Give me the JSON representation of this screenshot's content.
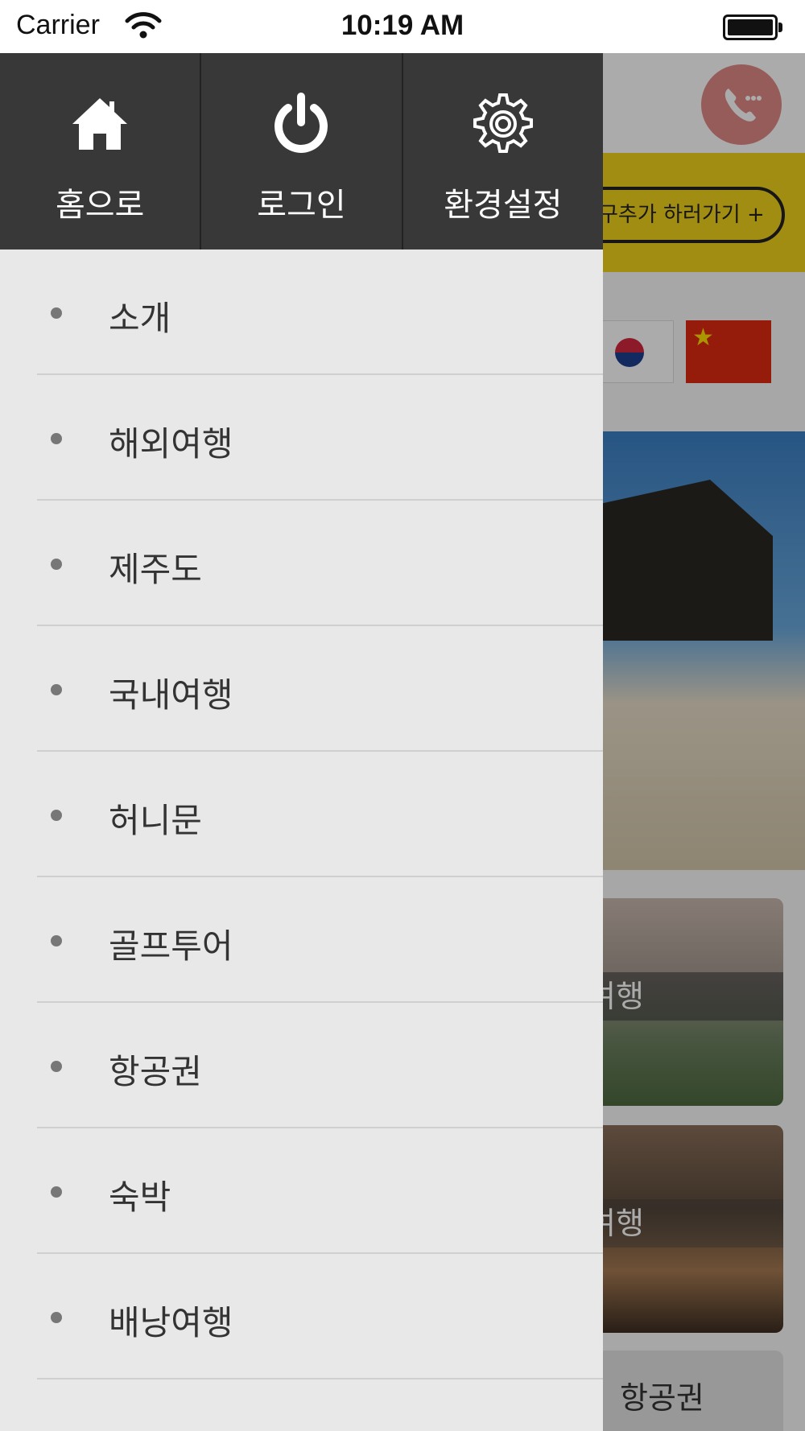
{
  "status_bar": {
    "carrier": "Carrier",
    "time": "10:19 AM",
    "wifi_icon": "wifi-icon",
    "battery_icon": "battery-icon"
  },
  "drawer": {
    "top_buttons": [
      {
        "label": "홈으로",
        "icon": "home-icon"
      },
      {
        "label": "로그인",
        "icon": "power-icon"
      },
      {
        "label": "환경설정",
        "icon": "gear-icon"
      }
    ],
    "menu_items": [
      {
        "label": "소개"
      },
      {
        "label": "해외여행"
      },
      {
        "label": "제주도"
      },
      {
        "label": "국내여행"
      },
      {
        "label": "허니문"
      },
      {
        "label": "골프투어"
      },
      {
        "label": "항공권"
      },
      {
        "label": "숙박"
      },
      {
        "label": "배낭여행"
      }
    ]
  },
  "background": {
    "call_icon": "phone-call-icon",
    "banner_text": "구추가 하러가기 +",
    "card_labels": [
      "여행",
      "여행",
      "항공권"
    ],
    "colors": {
      "banner": "#f2d31d",
      "call_button": "#e08a86",
      "drawer_header": "#383838",
      "drawer_body": "#e8e8e8"
    }
  }
}
